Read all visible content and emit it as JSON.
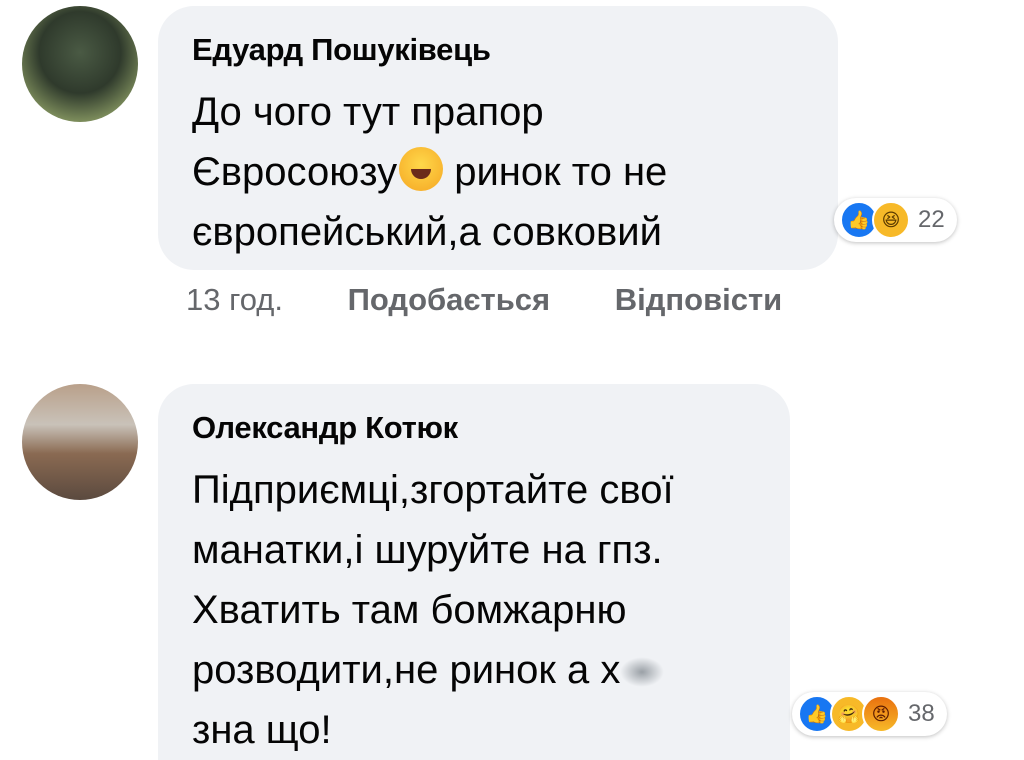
{
  "comments": [
    {
      "author": "Едуард Пошуківець",
      "text_before": "До чого тут прапор\nЄвросоюзу",
      "text_after": " ринок то не\nєвропейський,а совковий",
      "reaction_count": "22",
      "reactions": [
        "like-icon",
        "haha-icon"
      ],
      "time": "13 год.",
      "like_label": "Подобається",
      "reply_label": "Відповісти"
    },
    {
      "author": "Олександр Котюк",
      "text": "Підприємці,згортайте свої\nманатки,і шуруйте на гпз.\nХватить там бомжарню\nрозводити,не ринок а х",
      "text_end": "\nзна що!",
      "reaction_count": "38",
      "reactions": [
        "like-icon",
        "care-icon",
        "angry-icon"
      ]
    }
  ],
  "colors": {
    "bubble": "#f0f2f5",
    "meta_text": "#65676b",
    "like": "#1877f2",
    "haha": "#f7b928"
  }
}
